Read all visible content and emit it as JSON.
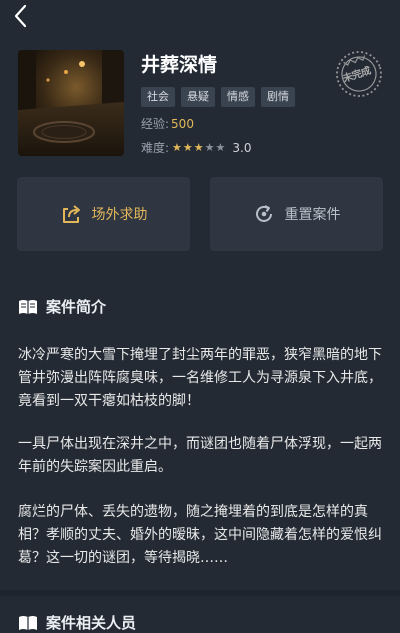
{
  "header": {
    "back_icon": "chevron-left-icon"
  },
  "case": {
    "title": "井葬深情",
    "stamp": "未完成",
    "tags": [
      "社会",
      "悬疑",
      "情感",
      "剧情"
    ],
    "exp_label": "经验:",
    "exp_value": "500",
    "difficulty_label": "难度:",
    "rating": 3,
    "rating_max": 5,
    "difficulty_score": "3.0"
  },
  "actions": {
    "help_label": "场外求助",
    "reset_label": "重置案件"
  },
  "intro": {
    "heading": "案件简介",
    "paragraphs": [
      "冰冷严寒的大雪下掩埋了封尘两年的罪恶，狭窄黑暗的地下管井弥漫出阵阵腐臭味，一名维修工人为寻源泉下入井底，竟看到一双干瘪如枯枝的脚！",
      "一具尸体出现在深井之中，而谜团也随着尸体浮现，一起两年前的失踪案因此重启。",
      "腐烂的尸体、丢失的遗物，随之掩埋着的到底是怎样的真相？孝顺的丈夫、婚外的暧昧，这中间隐藏着怎样的爱恨纠葛？这一切的谜团，等待揭晓……"
    ]
  },
  "people": {
    "heading": "案件相关人员"
  },
  "colors": {
    "accent": "#e2b75a",
    "background": "#232a34",
    "card": "#2f3641"
  }
}
